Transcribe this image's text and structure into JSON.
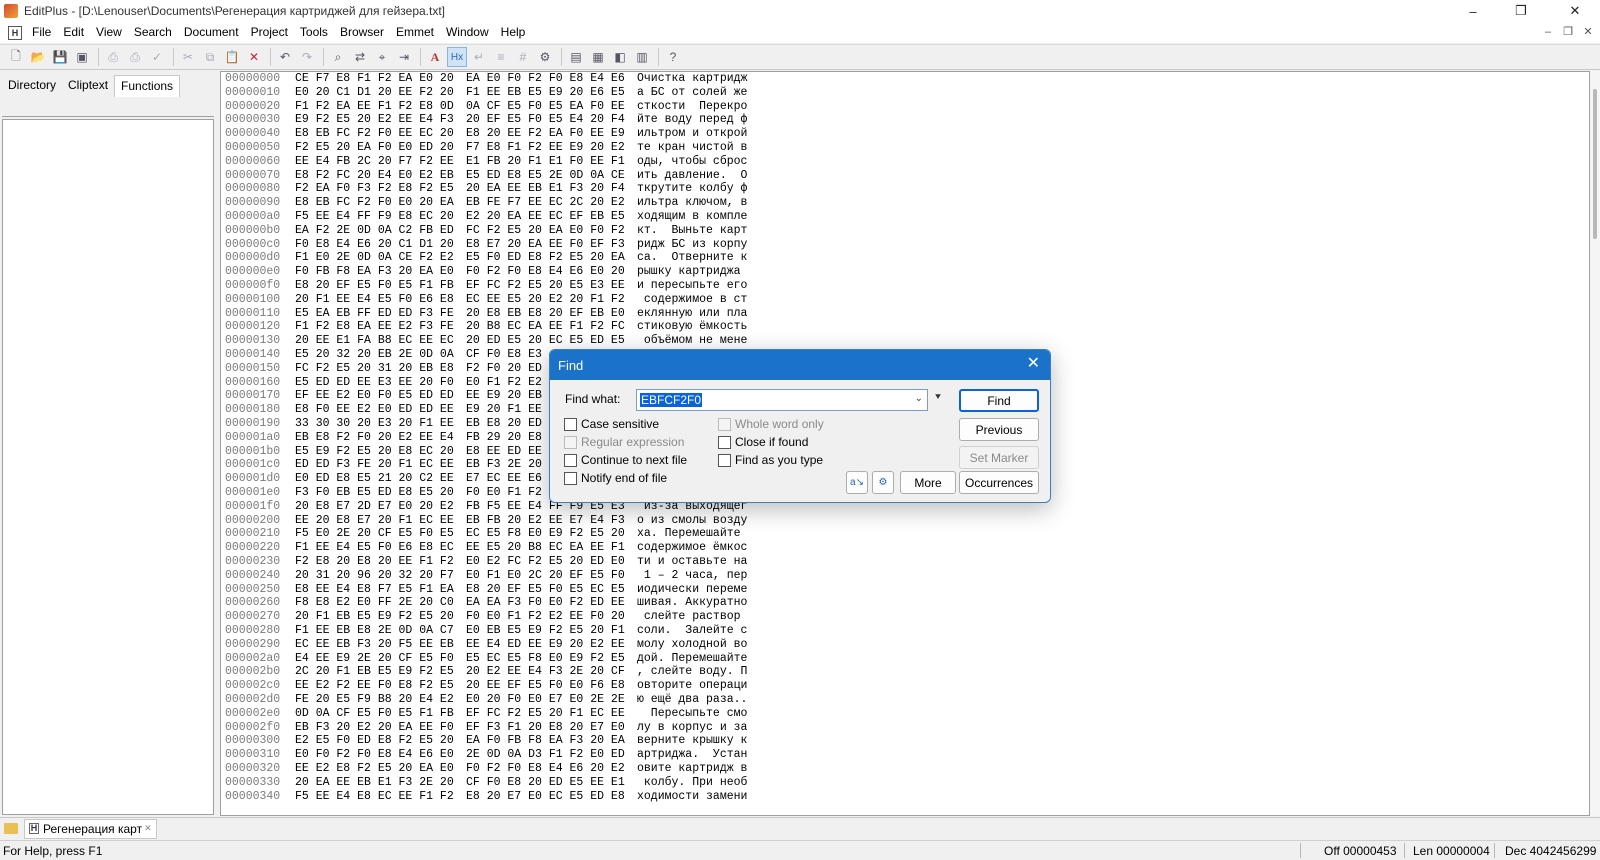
{
  "window": {
    "title": "EditPlus - [D:\\Lenouser\\Documents\\Регенерация картриджей для гейзера.txt]",
    "controls": {
      "minimize": "–",
      "restore": "❐",
      "close": "✕"
    }
  },
  "menubar": {
    "items": [
      "File",
      "Edit",
      "View",
      "Search",
      "Document",
      "Project",
      "Tools",
      "Browser",
      "Emmet",
      "Window",
      "Help"
    ],
    "mdi": {
      "minimize": "–",
      "restore": "❐",
      "close": "✕"
    }
  },
  "toolbar": {
    "buttons": [
      {
        "name": "new-file-icon",
        "glyph": "🗋"
      },
      {
        "name": "open-folder-icon",
        "glyph": "📂"
      },
      {
        "name": "save-icon",
        "glyph": "💾"
      },
      {
        "name": "save-all-icon",
        "glyph": "▣"
      },
      {
        "name": "print-preview-icon",
        "glyph": "⎙"
      },
      {
        "name": "print-icon",
        "glyph": "⎙"
      },
      {
        "name": "spell-check-icon",
        "glyph": "✓"
      },
      {
        "name": "cut-icon",
        "glyph": "✂"
      },
      {
        "name": "copy-icon",
        "glyph": "⧉"
      },
      {
        "name": "paste-icon",
        "glyph": "📋"
      },
      {
        "name": "delete-icon",
        "glyph": "✕"
      },
      {
        "name": "undo-icon",
        "glyph": "↶"
      },
      {
        "name": "redo-icon",
        "glyph": "↷"
      },
      {
        "name": "find-icon",
        "glyph": "⌕"
      },
      {
        "name": "replace-icon",
        "glyph": "⇄"
      },
      {
        "name": "find-in-files-icon",
        "glyph": "⌖"
      },
      {
        "name": "goto-icon",
        "glyph": "⇥"
      },
      {
        "name": "font-icon",
        "glyph": "A"
      },
      {
        "name": "hex-view-icon",
        "glyph": "Hx"
      },
      {
        "name": "word-wrap-icon",
        "glyph": "↵"
      },
      {
        "name": "ruler-icon",
        "glyph": "≡"
      },
      {
        "name": "line-number-icon",
        "glyph": "#"
      },
      {
        "name": "settings-icon",
        "glyph": "⚙"
      },
      {
        "name": "window-list-icon",
        "glyph": "▤"
      },
      {
        "name": "cliptext-icon",
        "glyph": "▦"
      },
      {
        "name": "browser-icon",
        "glyph": "◧"
      },
      {
        "name": "output-window-icon",
        "glyph": "▥"
      },
      {
        "name": "help-icon",
        "glyph": "?"
      }
    ]
  },
  "left_panel": {
    "tabs": [
      "Directory",
      "Cliptext",
      "Functions"
    ],
    "active_tab": "Functions"
  },
  "editor": {
    "rows": [
      {
        "addr": "00000000",
        "b1": "CE F7 E8 F1 F2 EA E0 20",
        "b2": "EA E0 F0 F2 F0 E8 E4 E6",
        "ascii": "Очистка картридж"
      },
      {
        "addr": "00000010",
        "b1": "E0 20 C1 D1 20 EE F2 20",
        "b2": "F1 EE EB E5 E9 20 E6 E5",
        "ascii": "а БС от солей же"
      },
      {
        "addr": "00000020",
        "b1": "F1 F2 EA EE F1 F2 E8 0D",
        "b2": "0A CF E5 F0 E5 EA F0 EE",
        "ascii": "сткости  Перекро"
      },
      {
        "addr": "00000030",
        "b1": "E9 F2 E5 20 E2 EE E4 F3",
        "b2": "20 EF E5 F0 E5 E4 20 F4",
        "ascii": "йте воду перед ф"
      },
      {
        "addr": "00000040",
        "b1": "E8 EB FC F2 F0 EE EC 20",
        "b2": "E8 20 EE F2 EA F0 EE E9",
        "ascii": "ильтром и открой"
      },
      {
        "addr": "00000050",
        "b1": "F2 E5 20 EA F0 E0 ED 20",
        "b2": "F7 E8 F1 F2 EE E9 20 E2",
        "ascii": "те кран чистой в"
      },
      {
        "addr": "00000060",
        "b1": "EE E4 FB 2C 20 F7 F2 EE",
        "b2": "E1 FB 20 F1 E1 F0 EE F1",
        "ascii": "оды, чтобы сброс"
      },
      {
        "addr": "00000070",
        "b1": "E8 F2 FC 20 E4 E0 E2 EB",
        "b2": "E5 ED E8 E5 2E 0D 0A CE",
        "ascii": "ить давление.  О"
      },
      {
        "addr": "00000080",
        "b1": "F2 EA F0 F3 F2 E8 F2 E5",
        "b2": "20 EA EE EB E1 F3 20 F4",
        "ascii": "ткрутите колбу ф"
      },
      {
        "addr": "00000090",
        "b1": "E8 EB FC F2 F0 E0 20 EA",
        "b2": "EB FE F7 EE EC 2C 20 E2",
        "ascii": "ильтра ключом, в"
      },
      {
        "addr": "000000a0",
        "b1": "F5 EE E4 FF F9 E8 EC 20",
        "b2": "E2 20 EA EE EC EF EB E5",
        "ascii": "ходящим в компле"
      },
      {
        "addr": "000000b0",
        "b1": "EA F2 2E 0D 0A C2 FB ED",
        "b2": "FC F2 E5 20 EA E0 F0 F2",
        "ascii": "кт.  Выньте карт"
      },
      {
        "addr": "000000c0",
        "b1": "F0 E8 E4 E6 20 C1 D1 20",
        "b2": "E8 E7 20 EA EE F0 EF F3",
        "ascii": "ридж БС из корпу"
      },
      {
        "addr": "000000d0",
        "b1": "F1 E0 2E 0D 0A CE F2 E2",
        "b2": "E5 F0 ED E8 F2 E5 20 EA",
        "ascii": "са.  Отверните к"
      },
      {
        "addr": "000000e0",
        "b1": "F0 FB F8 EA F3 20 EA E0",
        "b2": "F0 F2 F0 E8 E4 E6 E0 20",
        "ascii": "рышку картриджа "
      },
      {
        "addr": "000000f0",
        "b1": "E8 20 EF E5 F0 E5 F1 FB",
        "b2": "EF FC F2 E5 20 E5 E3 EE",
        "ascii": "и пересыпьте его"
      },
      {
        "addr": "00000100",
        "b1": "20 F1 EE E4 E5 F0 E6 E8",
        "b2": "EC EE E5 20 E2 20 F1 F2",
        "ascii": " содержимое в ст"
      },
      {
        "addr": "00000110",
        "b1": "E5 EA EB FF ED ED F3 FE",
        "b2": "20 E8 EB E8 20 EF EB E0",
        "ascii": "еклянную или пла"
      },
      {
        "addr": "00000120",
        "b1": "F1 F2 E8 EA EE E2 F3 FE",
        "b2": "20 B8 EC EA EE F1 F2 FC",
        "ascii": "стиковую ёмкость"
      },
      {
        "addr": "00000130",
        "b1": "20 EE E1 FA B8 EC EE EC",
        "b2": "20 ED E5 20 EC E5 ED E5",
        "ascii": " объёмом не мене"
      },
      {
        "addr": "00000140",
        "b1": "E5 20 32 20 EB 2E 0D 0A",
        "b2": "CF F0 E8 E3",
        "ascii": ""
      },
      {
        "addr": "00000150",
        "b1": "FC F2 E5 20 31 20 EB E8",
        "b2": "F2 F0 20 ED",
        "ascii": ""
      },
      {
        "addr": "00000160",
        "b1": "E5 ED ED EE E3 EE 20 F0",
        "b2": "E0 F1 F2 E2",
        "ascii": ""
      },
      {
        "addr": "00000170",
        "b1": "EF EE E2 E0 F0 E5 ED ED",
        "b2": "EE E9 20 EB",
        "ascii": ""
      },
      {
        "addr": "00000180",
        "b1": "E8 F0 EE E2 E0 ED ED EE",
        "b2": "E9 20 F1 EE",
        "ascii": ""
      },
      {
        "addr": "00000190",
        "b1": "33 30 30 20 E3 20 F1 EE",
        "b2": "EB E8 20 ED",
        "ascii": ""
      },
      {
        "addr": "000001a0",
        "b1": "EB E8 F2 F0 20 E2 EE E4",
        "b2": "FB 29 20 E8",
        "ascii": ""
      },
      {
        "addr": "000001b0",
        "b1": "E5 E9 F2 E5 20 E8 EC 20",
        "b2": "E8 EE ED EE",
        "ascii": ""
      },
      {
        "addr": "000001c0",
        "b1": "ED ED F3 FE 20 F1 EC EE",
        "b2": "EB F3 2E 20",
        "ascii": ""
      },
      {
        "addr": "000001d0",
        "b1": "E0 ED E8 E5 21 20 C2 EE",
        "b2": "E7 EC EE E6",
        "ascii": ""
      },
      {
        "addr": "000001e0",
        "b1": "F3 F0 EB E5 ED E8 E5 20",
        "b2": "F0 E0 F1 F2",
        "ascii": ""
      },
      {
        "addr": "000001f0",
        "b1": "20 E8 E7 2D E7 E0 20 E2",
        "b2": "FB F5 EE E4 FF F9 E5 E3",
        "ascii": " из-за выходящег"
      },
      {
        "addr": "00000200",
        "b1": "EE 20 E8 E7 20 F1 EC EE",
        "b2": "EB FB 20 E2 EE E7 E4 F3",
        "ascii": "о из смолы возду"
      },
      {
        "addr": "00000210",
        "b1": "F5 E0 2E 20 CF E5 F0 E5",
        "b2": "EC E5 F8 E0 E9 F2 E5 20",
        "ascii": "ха. Перемешайте "
      },
      {
        "addr": "00000220",
        "b1": "F1 EE E4 E5 F0 E6 E8 EC",
        "b2": "EE E5 20 B8 EC EA EE F1",
        "ascii": "содержимое ёмкос"
      },
      {
        "addr": "00000230",
        "b1": "F2 E8 20 E8 20 EE F1 F2",
        "b2": "E0 E2 FC F2 E5 20 ED E0",
        "ascii": "ти и оставьте на"
      },
      {
        "addr": "00000240",
        "b1": "20 31 20 96 20 32 20 F7",
        "b2": "E0 F1 E0 2C 20 EF E5 F0",
        "ascii": " 1 – 2 часа, пер"
      },
      {
        "addr": "00000250",
        "b1": "E8 EE E4 E8 F7 E5 F1 EA",
        "b2": "E8 20 EF E5 F0 E5 EC E5",
        "ascii": "иодически переме"
      },
      {
        "addr": "00000260",
        "b1": "F8 E8 E2 E0 FF 2E 20 C0",
        "b2": "EA EA F3 F0 E0 F2 ED EE",
        "ascii": "шивая. Аккуратно"
      },
      {
        "addr": "00000270",
        "b1": "20 F1 EB E5 E9 F2 E5 20",
        "b2": "F0 E0 F1 F2 E2 EE F0 20",
        "ascii": " слейте раствор "
      },
      {
        "addr": "00000280",
        "b1": "F1 EE EB E8 2E 0D 0A C7",
        "b2": "E0 EB E5 E9 F2 E5 20 F1",
        "ascii": "соли.  Залейте с"
      },
      {
        "addr": "00000290",
        "b1": "EC EE EB F3 20 F5 EE EB",
        "b2": "EE E4 ED EE E9 20 E2 EE",
        "ascii": "молу холодной во"
      },
      {
        "addr": "000002a0",
        "b1": "E4 EE E9 2E 20 CF E5 F0",
        "b2": "E5 EC E5 F8 E0 E9 F2 E5",
        "ascii": "дой. Перемешайте"
      },
      {
        "addr": "000002b0",
        "b1": "2C 20 F1 EB E5 E9 F2 E5",
        "b2": "20 E2 EE E4 F3 2E 20 CF",
        "ascii": ", слейте воду. П"
      },
      {
        "addr": "000002c0",
        "b1": "EE E2 F2 EE F0 E8 F2 E5",
        "b2": "20 EE EF E5 F0 E0 F6 E8",
        "ascii": "овторите операци"
      },
      {
        "addr": "000002d0",
        "b1": "FE 20 E5 F9 B8 20 E4 E2",
        "b2": "E0 20 F0 E0 E7 E0 2E 2E",
        "ascii": "ю ещё два раза.."
      },
      {
        "addr": "000002e0",
        "b1": "0D 0A CF E5 F0 E5 F1 FB",
        "b2": "EF FC F2 E5 20 F1 EC EE",
        "ascii": "  Пересыпьте смо"
      },
      {
        "addr": "000002f0",
        "b1": "EB F3 20 E2 20 EA EE F0",
        "b2": "EF F3 F1 20 E8 20 E7 E0",
        "ascii": "лу в корпус и за"
      },
      {
        "addr": "00000300",
        "b1": "E2 E5 F0 ED E8 F2 E5 20",
        "b2": "EA F0 FB F8 EA F3 20 EA",
        "ascii": "верните крышку к"
      },
      {
        "addr": "00000310",
        "b1": "E0 F0 F2 F0 E8 E4 E6 E0",
        "b2": "2E 0D 0A D3 F1 F2 E0 ED",
        "ascii": "артриджа.  Устан"
      },
      {
        "addr": "00000320",
        "b1": "EE E2 E8 F2 E5 20 EA E0",
        "b2": "F0 F2 F0 E8 E4 E6 20 E2",
        "ascii": "овите картридж в"
      },
      {
        "addr": "00000330",
        "b1": "20 EA EE EB E1 F3 2E 20",
        "b2": "CF F0 E8 20 ED E5 EE E1",
        "ascii": " колбу. При необ"
      },
      {
        "addr": "00000340",
        "b1": "F5 EE E4 E8 EC EE F1 F2",
        "b2": "E8 20 E7 E0 EC E5 ED E8",
        "ascii": "ходимости замени"
      }
    ]
  },
  "file_tabs": [
    {
      "label": "Регенерация карт",
      "close": "✕"
    }
  ],
  "statusbar": {
    "help": "For Help, press F1",
    "offset": "Off 00000453",
    "length": "Len 00000004",
    "decimal": "Dec 4042456299"
  },
  "find_dialog": {
    "title": "Find",
    "close": "✕",
    "find_what_label": "Find what:",
    "find_what_value": "EBFCF2F0",
    "history_arrow": "⯆",
    "combo_arrow": "⌄",
    "checkboxes": {
      "case_sensitive": "Case sensitive",
      "whole_word_only": "Whole word only",
      "regular_expression": "Regular expression",
      "close_if_found": "Close if found",
      "continue_to_next_file": "Continue to next file",
      "find_as_you_type": "Find as you type",
      "notify_end_of_file": "Notify end of file"
    },
    "buttons": {
      "find": "Find",
      "previous": "Previous",
      "set_marker": "Set Marker",
      "more": "More",
      "occurrences": "Occurrences"
    },
    "colors": {
      "titlebar": "#1a73c9",
      "selection": "#0a64d6"
    }
  }
}
